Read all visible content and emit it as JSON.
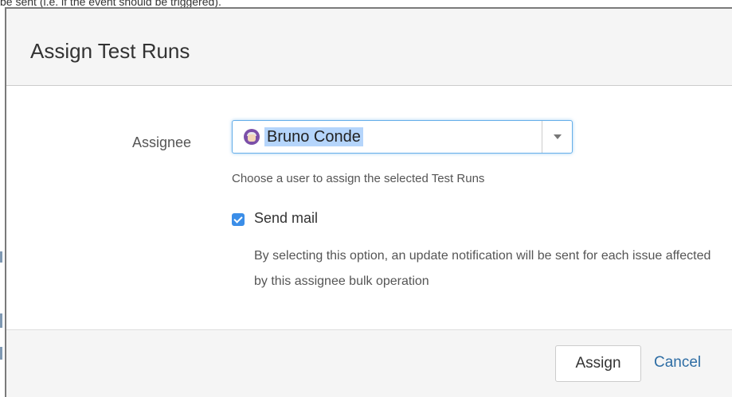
{
  "backdrop": {
    "visible_text": "be sent (i.e. if the event should be triggered)."
  },
  "dialog": {
    "title": "Assign Test Runs",
    "assignee": {
      "label": "Assignee",
      "selected_user": "Bruno Conde",
      "avatar_icon": "user-avatar-icon",
      "help_text": "Choose a user to assign the selected Test Runs"
    },
    "send_mail": {
      "checked": true,
      "label": "Send mail",
      "description": "By selecting this option, an update notification will be sent for each issue affected by this assignee bulk operation"
    },
    "footer": {
      "assign_label": "Assign",
      "cancel_label": "Cancel"
    }
  },
  "colors": {
    "accent": "#3b8ee8",
    "link": "#2e6da4",
    "selection_highlight": "#b5d5fb",
    "avatar_bg": "#7b4fa8"
  }
}
